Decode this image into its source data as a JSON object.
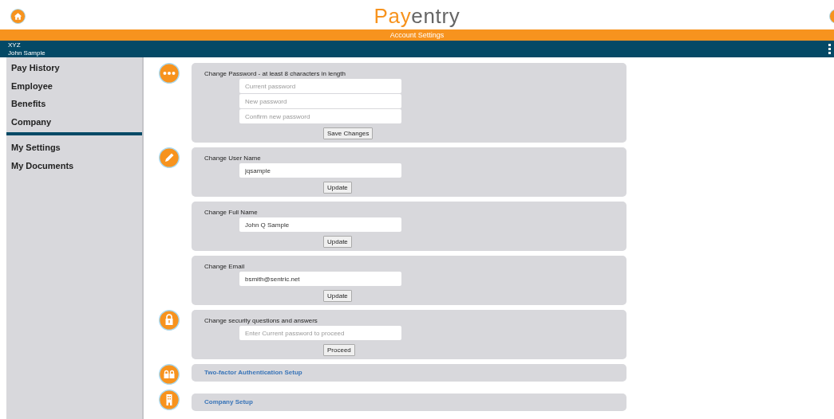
{
  "header": {
    "logo_part_1": "Pay",
    "logo_part_2": "entry",
    "title": "Account Settings"
  },
  "user_bar": {
    "company": "XYZ",
    "user": "John Sample"
  },
  "sidebar": {
    "groups": [
      [
        "Pay History",
        "Employee",
        "Benefits",
        "Company"
      ],
      [
        "My Settings",
        "My Documents"
      ]
    ]
  },
  "sections": [
    {
      "kind": "form",
      "title": "Change Password - at least 8 characters in length",
      "fields": [
        {
          "placeholder": "Current password"
        },
        {
          "placeholder": "New password"
        },
        {
          "placeholder": "Confirm new password"
        }
      ],
      "button": "Save Changes"
    },
    {
      "kind": "form",
      "title": "Change User Name",
      "fields": [
        {
          "value": "jqsample"
        }
      ],
      "button": "Update"
    },
    {
      "kind": "form",
      "title": "Change Full Name",
      "fields": [
        {
          "value": "John Q Sample"
        }
      ],
      "button": "Update"
    },
    {
      "kind": "form",
      "title": "Change Email",
      "fields": [
        {
          "value": "bsmith@sentric.net"
        }
      ],
      "button": "Update"
    },
    {
      "kind": "form",
      "title": "Change security questions and answers",
      "fields": [
        {
          "placeholder": "Enter Current password to proceed"
        }
      ],
      "button": "Proceed"
    },
    {
      "kind": "link",
      "title": "Two-factor Authentication Setup"
    },
    {
      "kind": "link",
      "title": "Company Setup"
    }
  ]
}
